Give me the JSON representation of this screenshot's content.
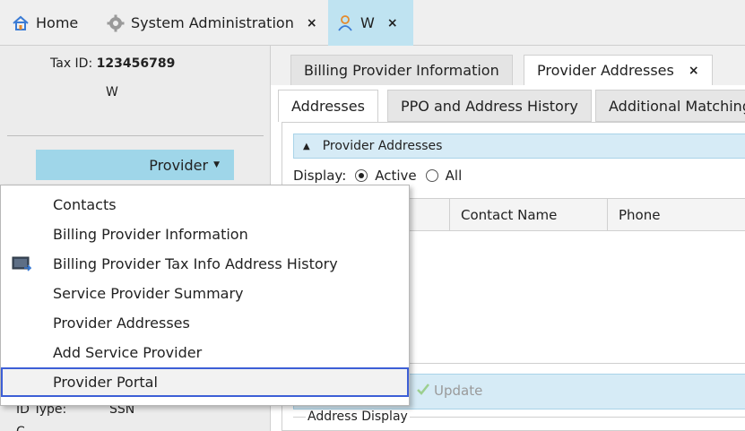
{
  "top_tabs": [
    {
      "label": "Home",
      "icon": "home-icon"
    },
    {
      "label": "System Administration",
      "icon": "gear-icon",
      "close": "×"
    },
    {
      "label": "W",
      "icon": "user-icon",
      "close": "×"
    }
  ],
  "left": {
    "tax_id_label": "Tax ID:",
    "tax_id_value": "123456789",
    "name": "W",
    "provider_button": "Provider",
    "id_type_label": "ID Type:",
    "id_type_value": "SSN",
    "cutoff_text": "C"
  },
  "menu": {
    "items": [
      {
        "label": "Contacts"
      },
      {
        "label": "Billing Provider Information"
      },
      {
        "label": "Billing Provider Tax Info Address History",
        "icon": "monitor-icon"
      },
      {
        "label": "Service Provider Summary"
      },
      {
        "label": "Provider Addresses"
      },
      {
        "label": "Add Service Provider"
      },
      {
        "label": "Provider Portal",
        "selected": true
      }
    ]
  },
  "right": {
    "tabs": [
      {
        "label": "Billing Provider Information"
      },
      {
        "label": "Provider Addresses",
        "close": "×",
        "active": true
      }
    ],
    "subtabs": [
      {
        "label": "Addresses",
        "active": true
      },
      {
        "label": "PPO and Address History"
      },
      {
        "label": "Additional Matching"
      }
    ],
    "section_title": "Provider Addresses",
    "display_label": "Display:",
    "display_options": [
      "Active",
      "All"
    ],
    "display_selected": "Active",
    "columns": [
      "",
      "Contact Name",
      "Phone"
    ],
    "update_label": "Update",
    "address_display_label": "Address Display"
  },
  "colors": {
    "accent": "#9fd6e9",
    "active_tab": "#bfe3f1",
    "section_header": "#d6ebf6",
    "selection_outline": "#3d5fd6"
  }
}
